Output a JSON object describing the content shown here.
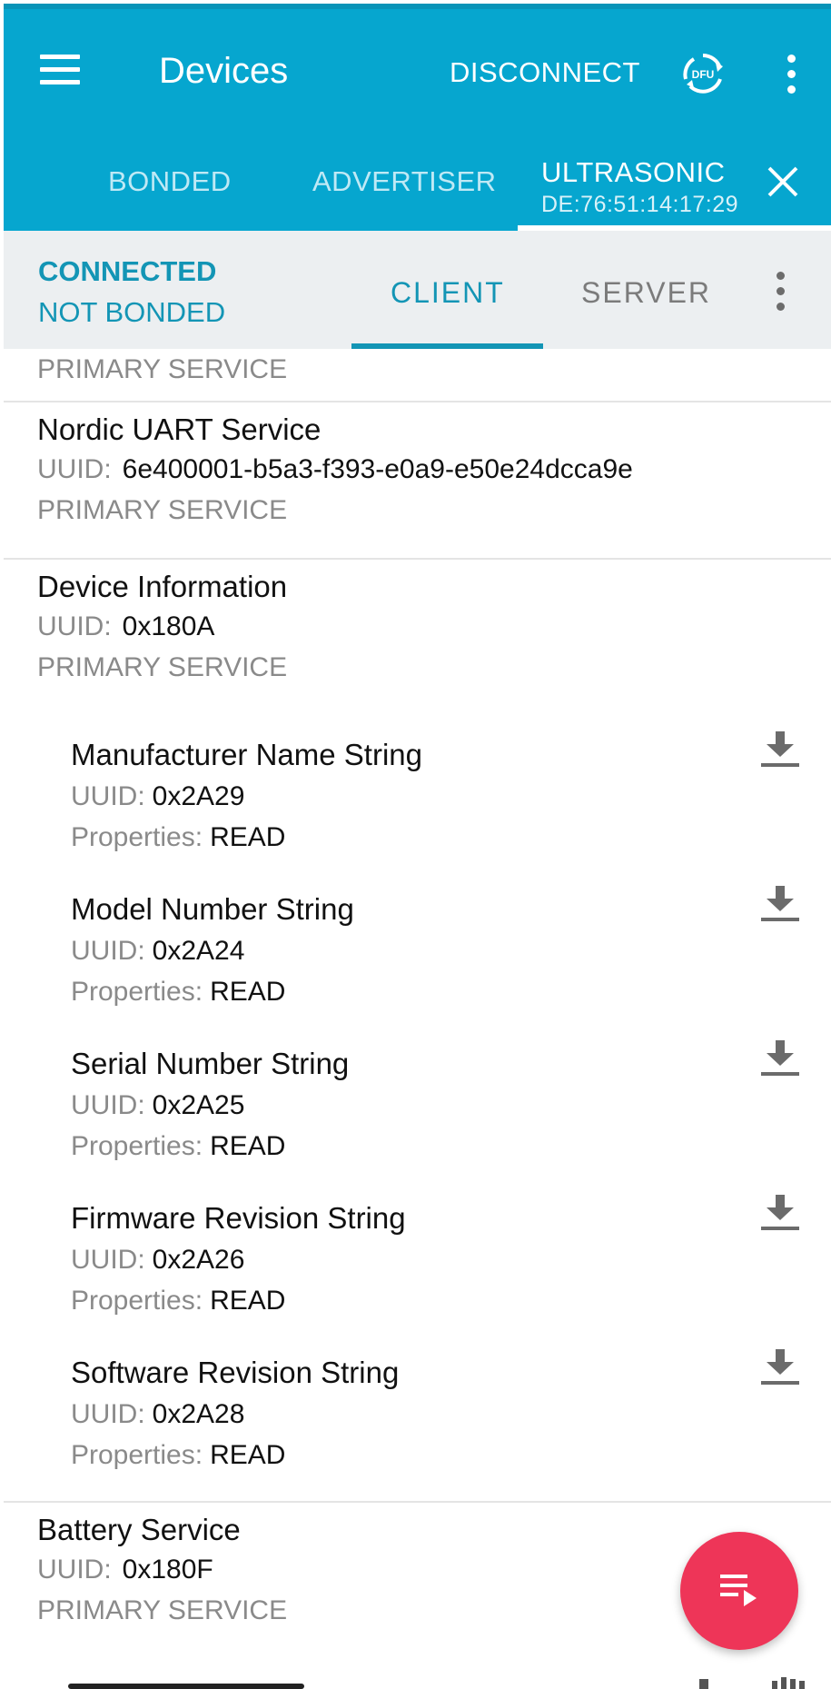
{
  "appbar": {
    "title": "Devices",
    "disconnect_label": "DISCONNECT",
    "dfu_label": "DFU",
    "tabs": [
      {
        "label": "BONDED"
      },
      {
        "label": "ADVERTISER"
      },
      {
        "label": "ULTRASONIC",
        "sublabel": "DE:76:51:14:17:29"
      }
    ],
    "active_tab": "ULTRASONIC"
  },
  "subbar": {
    "status": "CONNECTED",
    "bond_status": "NOT BONDED",
    "tabs": [
      {
        "label": "CLIENT"
      },
      {
        "label": "SERVER"
      }
    ],
    "active_tab": "CLIENT"
  },
  "services": {
    "partial_top": {
      "type": "PRIMARY SERVICE"
    },
    "items": [
      {
        "name": "Nordic UART Service",
        "uuid_label": "UUID:",
        "uuid": "6e400001-b5a3-f393-e0a9-e50e24dcca9e",
        "type": "PRIMARY SERVICE"
      },
      {
        "name": "Device Information",
        "uuid_label": "UUID:",
        "uuid": "0x180A",
        "type": "PRIMARY SERVICE"
      },
      {
        "name": "Battery Service",
        "uuid_label": "UUID:",
        "uuid": "0x180F",
        "type": "PRIMARY SERVICE"
      }
    ]
  },
  "characteristics": [
    {
      "name": "Manufacturer Name String",
      "uuid_label": "UUID:",
      "uuid": "0x2A29",
      "props_label": "Properties:",
      "props": "READ"
    },
    {
      "name": "Model Number String",
      "uuid_label": "UUID:",
      "uuid": "0x2A24",
      "props_label": "Properties:",
      "props": "READ"
    },
    {
      "name": "Serial Number String",
      "uuid_label": "UUID:",
      "uuid": "0x2A25",
      "props_label": "Properties:",
      "props": "READ"
    },
    {
      "name": "Firmware Revision String",
      "uuid_label": "UUID:",
      "uuid": "0x2A26",
      "props_label": "Properties:",
      "props": "READ"
    },
    {
      "name": "Software Revision String",
      "uuid_label": "UUID:",
      "uuid": "0x2A28",
      "props_label": "Properties:",
      "props": "READ"
    }
  ],
  "icons": {
    "menu": "menu-icon",
    "dfu": "dfu-icon",
    "more": "more-vert-icon",
    "close": "close-icon",
    "download": "download-icon",
    "fab": "playlist-play-icon"
  },
  "colors": {
    "appbar": "#06a6cf",
    "accent": "#1395b5",
    "subbar": "#eceff1",
    "fab": "#ee3558"
  }
}
